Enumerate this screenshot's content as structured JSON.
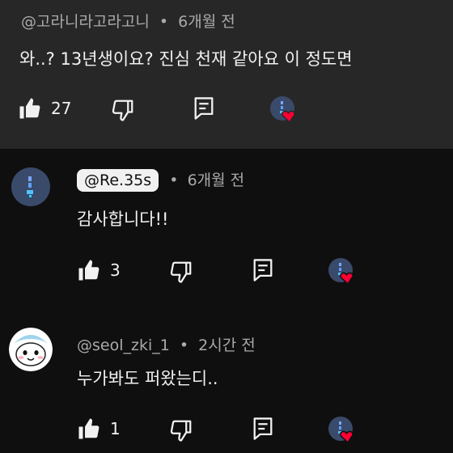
{
  "comments": [
    {
      "author": "@고라니라고라고니",
      "separator": "•",
      "time": "6개월 전",
      "text": "와..? 13년생이요? 진심 천재 같아요 이 정도면",
      "likes": "27"
    },
    {
      "author": "@Re.35s",
      "separator": "•",
      "time": "6개월 전",
      "text": "감사합니다!!",
      "likes": "3"
    },
    {
      "author": "@seol_zki_1",
      "separator": "•",
      "time": "2시간 전",
      "text": "누가봐도 퍼왔는디..",
      "likes": "1"
    }
  ],
  "colors": {
    "background": "#0f0f0f",
    "highlight_background": "#272727",
    "heart": "#ff0033",
    "creator_avatar": "#3a4a6b"
  }
}
